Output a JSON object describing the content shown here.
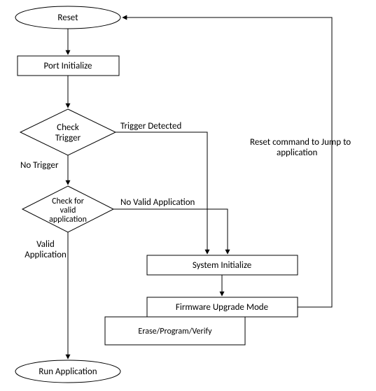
{
  "nodes": {
    "reset": "Reset",
    "port_init": "Port Initialize",
    "check_trigger_l1": "Check",
    "check_trigger_l2": "Trigger",
    "check_valid_l1": "Check for",
    "check_valid_l2": "valid",
    "check_valid_l3": "application",
    "sys_init": "System Initialize",
    "fw_mode": "Firmware Upgrade Mode",
    "fw_sub": "Erase/Program/Verify",
    "run_app": "Run Application"
  },
  "edges": {
    "trigger_detected": "Trigger Detected",
    "no_trigger": "No Trigger",
    "no_valid_app": "No Valid Application",
    "valid_app_l1": "Valid",
    "valid_app_l2": "Application",
    "reset_cmd_l1": "Reset command to Jump to",
    "reset_cmd_l2": "application"
  }
}
